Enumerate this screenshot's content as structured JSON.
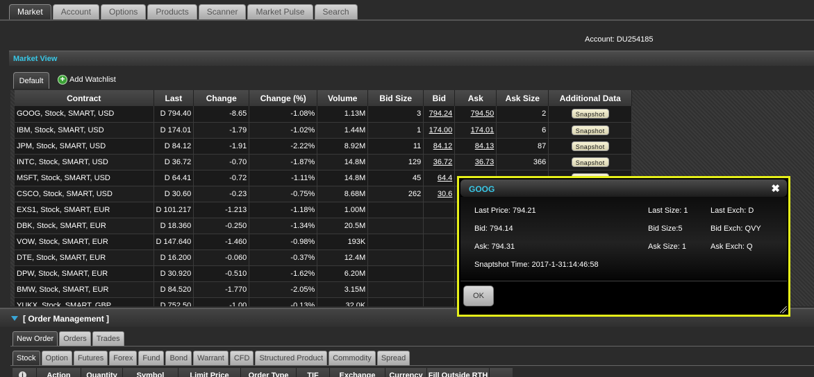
{
  "top_tabs": [
    "Market",
    "Account",
    "Options",
    "Products",
    "Scanner",
    "Market Pulse",
    "Search"
  ],
  "account_label": "Account: DU254185",
  "market_view": {
    "title": "Market View",
    "watchlist_tab": "Default",
    "add_watchlist": "Add Watchlist",
    "columns": [
      "Contract",
      "Last",
      "Change",
      "Change (%)",
      "Volume",
      "Bid Size",
      "Bid",
      "Ask",
      "Ask Size",
      "Additional Data"
    ],
    "snapshot_label": "Snapshot",
    "rows": [
      {
        "contract": "GOOG, Stock, SMART, USD",
        "last": "D 794.40",
        "change": "-8.65",
        "pct": "-1.08%",
        "volume": "1.13M",
        "bid_size": "3",
        "bid": "794.24",
        "ask": "794.50",
        "ask_size": "2",
        "snapshot": true
      },
      {
        "contract": "IBM, Stock, SMART, USD",
        "last": "D 174.01",
        "change": "-1.79",
        "pct": "-1.02%",
        "volume": "1.44M",
        "bid_size": "1",
        "bid": "174.00",
        "ask": "174.01",
        "ask_size": "6",
        "snapshot": true
      },
      {
        "contract": "JPM, Stock, SMART, USD",
        "last": "D 84.12",
        "change": "-1.91",
        "pct": "-2.22%",
        "volume": "8.92M",
        "bid_size": "11",
        "bid": "84.12",
        "ask": "84.13",
        "ask_size": "87",
        "snapshot": true
      },
      {
        "contract": "INTC, Stock, SMART, USD",
        "last": "D 36.72",
        "change": "-0.70",
        "pct": "-1.87%",
        "volume": "14.8M",
        "bid_size": "129",
        "bid": "36.72",
        "ask": "36.73",
        "ask_size": "366",
        "snapshot": true
      },
      {
        "contract": "MSFT, Stock, SMART, USD",
        "last": "D 64.41",
        "change": "-0.72",
        "pct": "-1.11%",
        "volume": "14.8M",
        "bid_size": "45",
        "bid": "64.4",
        "ask": "",
        "ask_size": "",
        "snapshot": true
      },
      {
        "contract": "CSCO, Stock, SMART, USD",
        "last": "D 30.60",
        "change": "-0.23",
        "pct": "-0.75%",
        "volume": "8.68M",
        "bid_size": "262",
        "bid": "30.6",
        "ask": "",
        "ask_size": "",
        "snapshot": false
      },
      {
        "contract": "EXS1, Stock, SMART, EUR",
        "last": "D 101.217",
        "change": "-1.213",
        "pct": "-1.18%",
        "volume": "1.00M",
        "bid_size": "",
        "bid": "",
        "ask": "",
        "ask_size": "",
        "snapshot": false
      },
      {
        "contract": "DBK, Stock, SMART, EUR",
        "last": "D 18.360",
        "change": "-0.250",
        "pct": "-1.34%",
        "volume": "20.5M",
        "bid_size": "",
        "bid": "",
        "ask": "",
        "ask_size": "",
        "snapshot": false
      },
      {
        "contract": "VOW, Stock, SMART, EUR",
        "last": "D 147.640",
        "change": "-1.460",
        "pct": "-0.98%",
        "volume": "193K",
        "bid_size": "",
        "bid": "",
        "ask": "",
        "ask_size": "",
        "snapshot": false
      },
      {
        "contract": "DTE, Stock, SMART, EUR",
        "last": "D 16.200",
        "change": "-0.060",
        "pct": "-0.37%",
        "volume": "12.4M",
        "bid_size": "",
        "bid": "",
        "ask": "",
        "ask_size": "",
        "snapshot": false
      },
      {
        "contract": "DPW, Stock, SMART, EUR",
        "last": "D 30.920",
        "change": "-0.510",
        "pct": "-1.62%",
        "volume": "6.20M",
        "bid_size": "",
        "bid": "",
        "ask": "",
        "ask_size": "",
        "snapshot": false
      },
      {
        "contract": "BMW, Stock, SMART, EUR",
        "last": "D 84.520",
        "change": "-1.770",
        "pct": "-2.05%",
        "volume": "3.15M",
        "bid_size": "",
        "bid": "",
        "ask": "",
        "ask_size": "",
        "snapshot": false
      },
      {
        "contract": "YUKX, Stock, SMART, GBP",
        "last": "D 752.50",
        "change": "-1.00",
        "pct": "-0.13%",
        "volume": "32.0K",
        "bid_size": "",
        "bid": "",
        "ask": "",
        "ask_size": "",
        "snapshot": false
      }
    ]
  },
  "order_management": {
    "title": "[ Order Management ]",
    "tabs": [
      "New Order",
      "Orders",
      "Trades"
    ],
    "product_tabs": [
      "Stock",
      "Option",
      "Futures",
      "Forex",
      "Fund",
      "Bond",
      "Warrant",
      "CFD",
      "Structured Product",
      "Commodity",
      "Spread"
    ],
    "columns": [
      "Action",
      "Quantity",
      "Symbol",
      "Limit Price",
      "Order Type",
      "TIF",
      "Exchange",
      "Currency",
      "Fill Outside RTH"
    ]
  },
  "popup": {
    "title": "GOOG",
    "last_price": "Last Price: 794.21",
    "last_size": "Last Size: 1",
    "last_exch": "Last Exch: D",
    "bid": "Bid: 794.14",
    "bid_size": "Bid Size:5",
    "bid_exch": "Bid Exch: QVY",
    "ask": "Ask: 794.31",
    "ask_size": "Ask Size: 1",
    "ask_exch": "Ask Exch: Q",
    "snapshot_time": "Snaptshot Time: 2017-1-31:14:46:58",
    "ok_label": "OK"
  }
}
